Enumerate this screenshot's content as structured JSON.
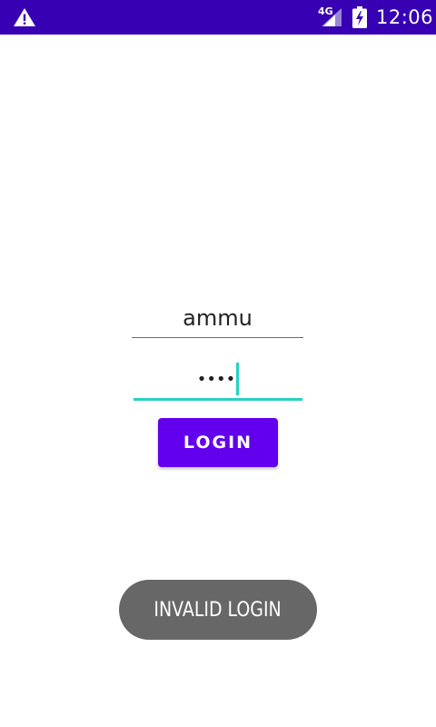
{
  "status_bar": {
    "network_type": "4G",
    "time": "12:06",
    "icons": [
      "warning-icon",
      "signal-icon",
      "battery-charging-icon"
    ],
    "background": "#3700b3"
  },
  "login_form": {
    "username_value": "ammu",
    "password_masked": "••••",
    "login_label": "LOGIN",
    "accent_color": "#26d2c4",
    "button_color": "#6200ee"
  },
  "toast": {
    "message": "INVALID LOGIN"
  }
}
